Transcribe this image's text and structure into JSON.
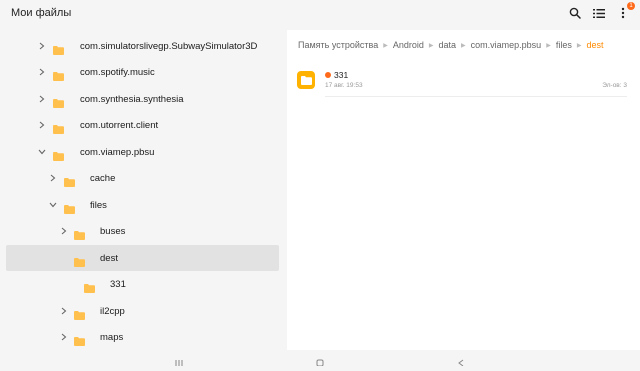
{
  "header": {
    "title": "Мои файлы",
    "icons": [
      "search-icon",
      "list-view-icon",
      "more-icon"
    ],
    "notification_badge": "1"
  },
  "tree": [
    {
      "label": "com.simulatorslivegp.SubwaySimulator3D",
      "expanded": false,
      "selected": false
    },
    {
      "label": "com.spotify.music",
      "expanded": false,
      "selected": false
    },
    {
      "label": "com.synthesia.synthesia",
      "expanded": false,
      "selected": false
    },
    {
      "label": "com.utorrent.client",
      "expanded": false,
      "selected": false
    },
    {
      "label": "com.viamep.pbsu",
      "expanded": true,
      "selected": false
    },
    {
      "label": "cache",
      "expanded": false,
      "selected": false
    },
    {
      "label": "files",
      "expanded": true,
      "selected": false
    },
    {
      "label": "buses",
      "expanded": false,
      "selected": false
    },
    {
      "label": "dest",
      "expanded": false,
      "selected": true
    },
    {
      "label": "331",
      "expanded": false,
      "selected": false
    },
    {
      "label": "il2cpp",
      "expanded": false,
      "selected": false
    },
    {
      "label": "maps",
      "expanded": false,
      "selected": false
    }
  ],
  "breadcrumb": [
    "Память устройства",
    "Android",
    "data",
    "com.viamep.pbsu",
    "files",
    "dest"
  ],
  "files": [
    {
      "name": "331",
      "date": "17 авг. 19:53",
      "count": "Эл-ов: 3"
    }
  ],
  "colors": {
    "accent": "#ff8a00",
    "folder": "#ffb300",
    "badge": "#ff6a1a",
    "selected_bg": "#e2e2e2"
  }
}
